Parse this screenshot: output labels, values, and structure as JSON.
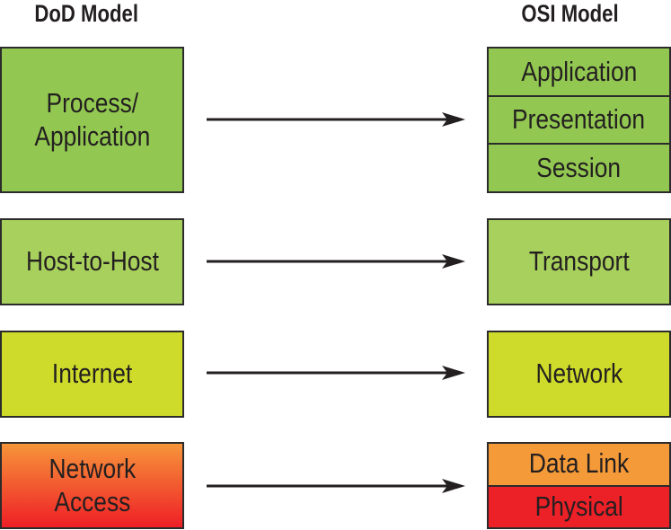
{
  "headings": {
    "left": "DoD Model",
    "right": "OSI Model"
  },
  "colors": {
    "green": "#92c851",
    "light_green": "#a8d05c",
    "yellow_green": "#cedb2a",
    "orange": "#f59a39",
    "red": "#ec2027",
    "gradient_top": "#f7953a",
    "gradient_bottom": "#ee1f26",
    "border": "#2b2b2b",
    "arrow": "#231f20"
  },
  "dod_layers": [
    {
      "label": "Process/\nApplication"
    },
    {
      "label": "Host-to-Host"
    },
    {
      "label": "Internet"
    },
    {
      "label": "Network\nAccess"
    }
  ],
  "osi_groups": [
    {
      "layers": [
        "Application",
        "Presentation",
        "Session"
      ]
    },
    {
      "layers": [
        "Transport"
      ]
    },
    {
      "layers": [
        "Network"
      ]
    },
    {
      "layers": [
        "Data Link",
        "Physical"
      ]
    }
  ],
  "mappings": [
    {
      "from": "Process/Application",
      "to": "Application, Presentation, Session"
    },
    {
      "from": "Host-to-Host",
      "to": "Transport"
    },
    {
      "from": "Internet",
      "to": "Network"
    },
    {
      "from": "Network Access",
      "to": "Data Link, Physical"
    }
  ]
}
